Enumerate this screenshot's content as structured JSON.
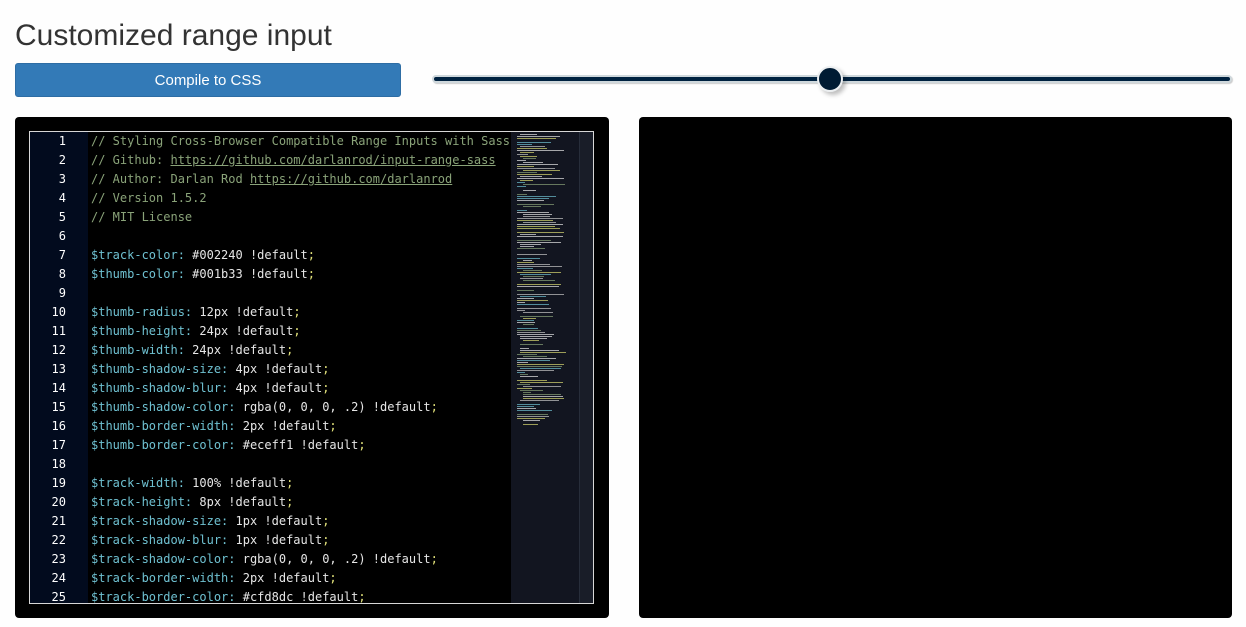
{
  "page": {
    "title": "Customized range input"
  },
  "toolbar": {
    "compile_label": "Compile to CSS"
  },
  "slider": {
    "value_fraction": 0.4975,
    "track_color": "#002240",
    "thumb_color": "#001b33",
    "thumb_border_color": "#eceff1",
    "track_border_color": "#cfd8dc"
  },
  "editor": {
    "lines": [
      {
        "n": "1",
        "parts": [
          {
            "t": "// Styling Cross-Browser Compatible Range Inputs with Sass",
            "c": "comment"
          }
        ]
      },
      {
        "n": "2",
        "parts": [
          {
            "t": "// Github: ",
            "c": "comment"
          },
          {
            "t": "https://github.com/darlanrod/input-range-sass",
            "c": "link"
          }
        ]
      },
      {
        "n": "3",
        "parts": [
          {
            "t": "// Author: Darlan Rod ",
            "c": "comment"
          },
          {
            "t": "https://github.com/darlanrod",
            "c": "link"
          }
        ]
      },
      {
        "n": "4",
        "parts": [
          {
            "t": "// Version 1.5.2",
            "c": "comment"
          }
        ]
      },
      {
        "n": "5",
        "parts": [
          {
            "t": "// MIT License",
            "c": "comment"
          }
        ]
      },
      {
        "n": "6",
        "parts": []
      },
      {
        "n": "7",
        "parts": [
          {
            "t": "$track-color:",
            "c": "var"
          },
          {
            "t": " #002240 !default",
            "c": "val"
          },
          {
            "t": ";",
            "c": "semi"
          }
        ]
      },
      {
        "n": "8",
        "parts": [
          {
            "t": "$thumb-color:",
            "c": "var"
          },
          {
            "t": " #001b33 !default",
            "c": "val"
          },
          {
            "t": ";",
            "c": "semi"
          }
        ]
      },
      {
        "n": "9",
        "parts": []
      },
      {
        "n": "10",
        "parts": [
          {
            "t": "$thumb-radius:",
            "c": "var"
          },
          {
            "t": " 12px !default",
            "c": "val"
          },
          {
            "t": ";",
            "c": "semi"
          }
        ]
      },
      {
        "n": "11",
        "parts": [
          {
            "t": "$thumb-height:",
            "c": "var"
          },
          {
            "t": " 24px !default",
            "c": "val"
          },
          {
            "t": ";",
            "c": "semi"
          }
        ]
      },
      {
        "n": "12",
        "parts": [
          {
            "t": "$thumb-width:",
            "c": "var"
          },
          {
            "t": " 24px !default",
            "c": "val"
          },
          {
            "t": ";",
            "c": "semi"
          }
        ]
      },
      {
        "n": "13",
        "parts": [
          {
            "t": "$thumb-shadow-size:",
            "c": "var"
          },
          {
            "t": " 4px !default",
            "c": "val"
          },
          {
            "t": ";",
            "c": "semi"
          }
        ]
      },
      {
        "n": "14",
        "parts": [
          {
            "t": "$thumb-shadow-blur:",
            "c": "var"
          },
          {
            "t": " 4px !default",
            "c": "val"
          },
          {
            "t": ";",
            "c": "semi"
          }
        ]
      },
      {
        "n": "15",
        "parts": [
          {
            "t": "$thumb-shadow-color:",
            "c": "var"
          },
          {
            "t": " rgba(0, 0, 0, .2) !default",
            "c": "val"
          },
          {
            "t": ";",
            "c": "semi"
          }
        ]
      },
      {
        "n": "16",
        "parts": [
          {
            "t": "$thumb-border-width:",
            "c": "var"
          },
          {
            "t": " 2px !default",
            "c": "val"
          },
          {
            "t": ";",
            "c": "semi"
          }
        ]
      },
      {
        "n": "17",
        "parts": [
          {
            "t": "$thumb-border-color:",
            "c": "var"
          },
          {
            "t": " #eceff1 !default",
            "c": "val"
          },
          {
            "t": ";",
            "c": "semi"
          }
        ]
      },
      {
        "n": "18",
        "parts": []
      },
      {
        "n": "19",
        "parts": [
          {
            "t": "$track-width:",
            "c": "var"
          },
          {
            "t": " 100% !default",
            "c": "val"
          },
          {
            "t": ";",
            "c": "semi"
          }
        ]
      },
      {
        "n": "20",
        "parts": [
          {
            "t": "$track-height:",
            "c": "var"
          },
          {
            "t": " 8px !default",
            "c": "val"
          },
          {
            "t": ";",
            "c": "semi"
          }
        ]
      },
      {
        "n": "21",
        "parts": [
          {
            "t": "$track-shadow-size:",
            "c": "var"
          },
          {
            "t": " 1px !default",
            "c": "val"
          },
          {
            "t": ";",
            "c": "semi"
          }
        ]
      },
      {
        "n": "22",
        "parts": [
          {
            "t": "$track-shadow-blur:",
            "c": "var"
          },
          {
            "t": " 1px !default",
            "c": "val"
          },
          {
            "t": ";",
            "c": "semi"
          }
        ]
      },
      {
        "n": "23",
        "parts": [
          {
            "t": "$track-shadow-color:",
            "c": "var"
          },
          {
            "t": " rgba(0, 0, 0, .2) !default",
            "c": "val"
          },
          {
            "t": ";",
            "c": "semi"
          }
        ]
      },
      {
        "n": "24",
        "parts": [
          {
            "t": "$track-border-width:",
            "c": "var"
          },
          {
            "t": " 2px !default",
            "c": "val"
          },
          {
            "t": ";",
            "c": "semi"
          }
        ]
      },
      {
        "n": "25",
        "parts": [
          {
            "t": "$track-border-color:",
            "c": "var"
          },
          {
            "t": " #cfd8dc !default",
            "c": "val"
          },
          {
            "t": ";",
            "c": "semi"
          }
        ]
      }
    ]
  }
}
